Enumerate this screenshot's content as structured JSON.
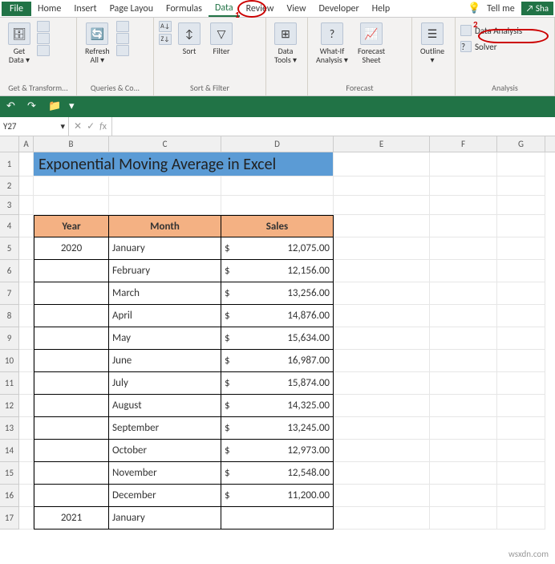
{
  "menu": {
    "file": "File",
    "tabs": [
      "Home",
      "Insert",
      "Page Layou",
      "Formulas",
      "Data",
      "Review",
      "View",
      "Developer",
      "Help"
    ],
    "tellme_icon": "bulb-icon",
    "tellme": "Tell me",
    "share": "Sha"
  },
  "callouts": {
    "n1": "1",
    "n2": "2"
  },
  "ribbon": {
    "groups": {
      "get_transform": {
        "label": "Get & Transform...",
        "get_data": "Get\nData ▾"
      },
      "queries": {
        "label": "Queries & Co...",
        "refresh": "Refresh\nAll ▾"
      },
      "sort_filter": {
        "label": "Sort & Filter",
        "sort": "Sort",
        "filter": "Filter"
      },
      "data_tools": {
        "label": "",
        "tools": "Data\nTools ▾"
      },
      "forecast": {
        "label": "Forecast",
        "whatif": "What-If\nAnalysis ▾",
        "sheet": "Forecast\nSheet"
      },
      "outline": {
        "label": "",
        "outline": "Outline\n▾"
      },
      "analysis": {
        "label": "Analysis",
        "data_analysis": "Data Analysis",
        "solver": "Solver"
      }
    }
  },
  "qat": {
    "undo": "↶",
    "redo": "↷",
    "folder": "📁"
  },
  "namebox": "Y27",
  "formula": "",
  "cols": [
    "A",
    "B",
    "C",
    "D",
    "E",
    "F",
    "G"
  ],
  "title": "Exponential Moving Average in Excel",
  "table": {
    "headers": {
      "year": "Year",
      "month": "Month",
      "sales": "Sales"
    },
    "currency": "$",
    "rows": [
      {
        "year": "2020",
        "month": "January",
        "sales": "12,075.00"
      },
      {
        "year": "",
        "month": "February",
        "sales": "12,156.00"
      },
      {
        "year": "",
        "month": "March",
        "sales": "13,256.00"
      },
      {
        "year": "",
        "month": "April",
        "sales": "14,876.00"
      },
      {
        "year": "",
        "month": "May",
        "sales": "15,634.00"
      },
      {
        "year": "",
        "month": "June",
        "sales": "16,987.00"
      },
      {
        "year": "",
        "month": "July",
        "sales": "15,874.00"
      },
      {
        "year": "",
        "month": "August",
        "sales": "14,325.00"
      },
      {
        "year": "",
        "month": "September",
        "sales": "13,245.00"
      },
      {
        "year": "",
        "month": "October",
        "sales": "12,973.00"
      },
      {
        "year": "",
        "month": "November",
        "sales": "12,548.00"
      },
      {
        "year": "",
        "month": "December",
        "sales": "11,200.00"
      },
      {
        "year": "2021",
        "month": "January",
        "sales": ""
      }
    ]
  },
  "watermark": "wsxdn.com"
}
